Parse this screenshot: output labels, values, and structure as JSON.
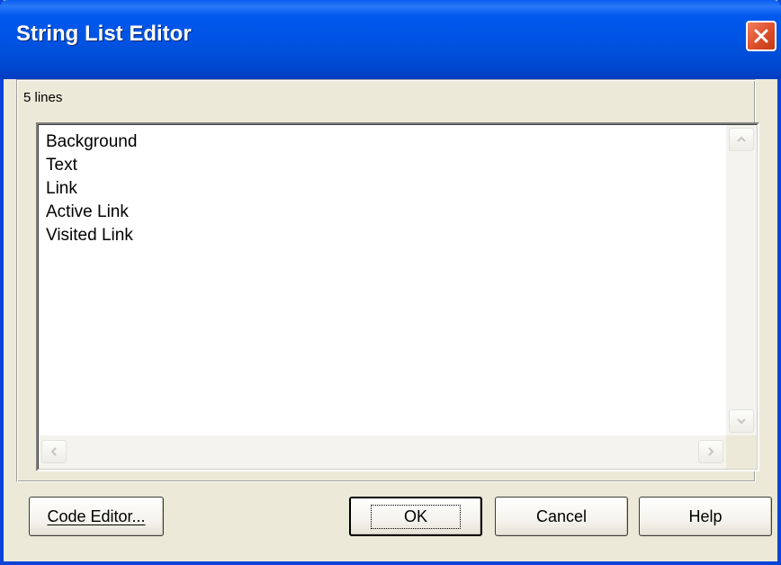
{
  "window": {
    "title": "String List Editor"
  },
  "editor": {
    "line_count_label": "5 lines",
    "lines": [
      "Background",
      "Text",
      "Link",
      "Active Link",
      "Visited Link"
    ]
  },
  "buttons": {
    "code_editor": "Code Editor...",
    "ok": "OK",
    "cancel": "Cancel",
    "help": "Help"
  },
  "icons": {
    "close": "close-icon",
    "scroll_up": "chevron-up-icon",
    "scroll_down": "chevron-down-icon",
    "scroll_left": "chevron-left-icon",
    "scroll_right": "chevron-right-icon"
  },
  "colors": {
    "titlebar": "#0054e3",
    "close_button": "#e0502e",
    "dialog_face": "#ece9d8"
  }
}
